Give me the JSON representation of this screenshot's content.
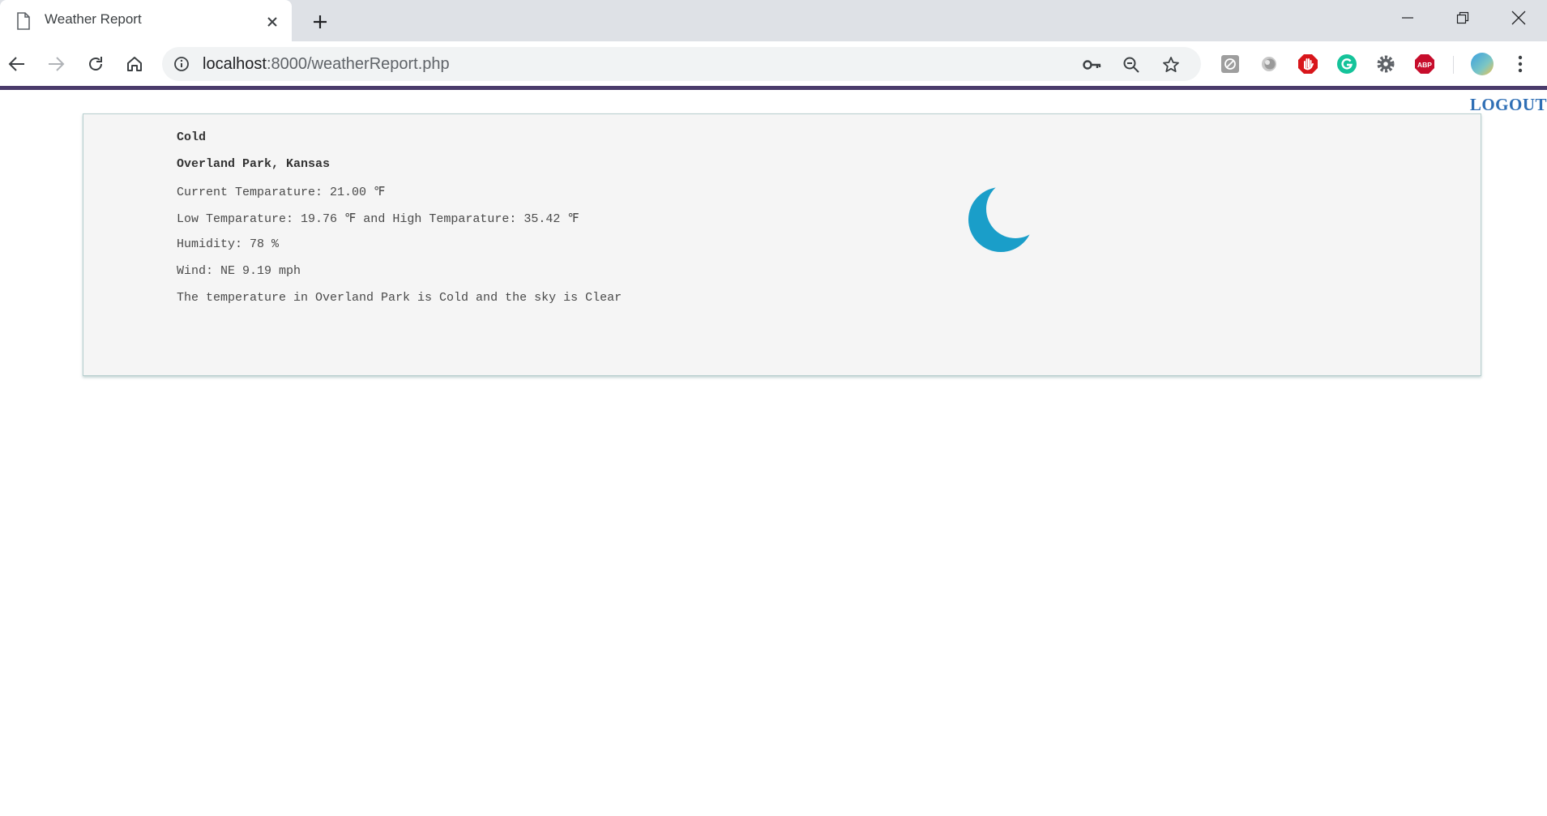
{
  "browser": {
    "tab_title": "Weather Report",
    "url_host": "localhost",
    "url_path": ":8000/weatherReport.php",
    "extensions": [
      "ghostery-icon",
      "circle-extension-icon",
      "adblock-hand-icon",
      "grammarly-icon",
      "gear-extension-icon",
      "adblock-plus-icon"
    ],
    "ext_labels": {
      "abp": "ABP"
    }
  },
  "page": {
    "logout_label": "LOGOUT",
    "weather": {
      "condition": "Cold",
      "location": "Overland Park, Kansas",
      "current_temp": "Current Temparature: 21.00 ℉",
      "low_high": "Low Temparature: 19.76 ℉ and High Temparature: 35.42 ℉",
      "humidity": "Humidity: 78 %",
      "wind": "Wind: NE 9.19 mph",
      "summary": "The temperature in Overland Park is Cold and the sky is Clear",
      "icon": "crescent-moon-icon",
      "icon_color": "#1a9ec9"
    }
  },
  "colors": {
    "accent_bar": "#4a3b6b",
    "logout": "#2f6fb5",
    "card_bg": "#f5f5f5"
  }
}
